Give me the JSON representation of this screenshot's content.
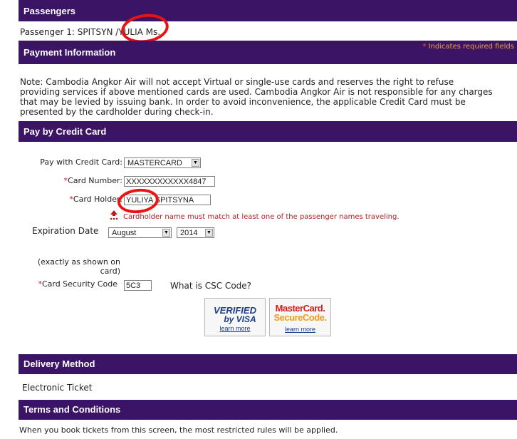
{
  "passengers": {
    "title": "Passengers",
    "passenger_line": "Passenger 1: SPITSYN /YULIA Ms."
  },
  "payment_info": {
    "title": "Payment Information",
    "required_note": "Indicates required fields",
    "required_star": "*",
    "note_lines": [
      "Note: Cambodia Angkor Air will not accept Virtual or single-use cards and reserves the right to refuse",
      "providing services if above mentioned cards are used. Cambodia Angkor Air is not responsible for any charges",
      "that may be levied by issuing bank. In order to avoid inconvenience, the applicable Credit Card must be",
      "presented by the cardholder during check-in."
    ]
  },
  "credit_card": {
    "title": "Pay by Credit Card",
    "pay_with_label": "Pay with Credit Card:",
    "card_type": "MASTERCARD",
    "card_number_label": "Card Number:",
    "card_number_value": "XXXXXXXXXXXX4847",
    "card_holder_label": "Card Holder:",
    "card_holder_value": "YULIYA SPITSYNA",
    "card_holder_warning": "Cardholder name must match at least one of the passenger names traveling.",
    "expiration_label": "Expiration Date",
    "expiration_month": "August",
    "expiration_year": "2014",
    "exact_note_line1": "(exactly as shown on",
    "exact_note_line2": "card)",
    "csc_label": "Card Security Code",
    "csc_value": "5C3",
    "csc_help": "What is CSC Code?",
    "required_star": "*",
    "verified_visa": {
      "line1": "VERIFIED",
      "line2": "by VISA",
      "link": "learn more"
    },
    "mastercard_secure": {
      "line1": "MasterCard.",
      "line2": "SecureCode.",
      "link": "learn more"
    },
    "arrow_color": "#ee1111",
    "header_color": "#3b1466"
  },
  "delivery": {
    "title": "Delivery Method",
    "value": "Electronic Ticket"
  },
  "terms": {
    "title": "Terms and Conditions",
    "text": "When you book tickets from this screen, the most restricted rules will be applied."
  }
}
